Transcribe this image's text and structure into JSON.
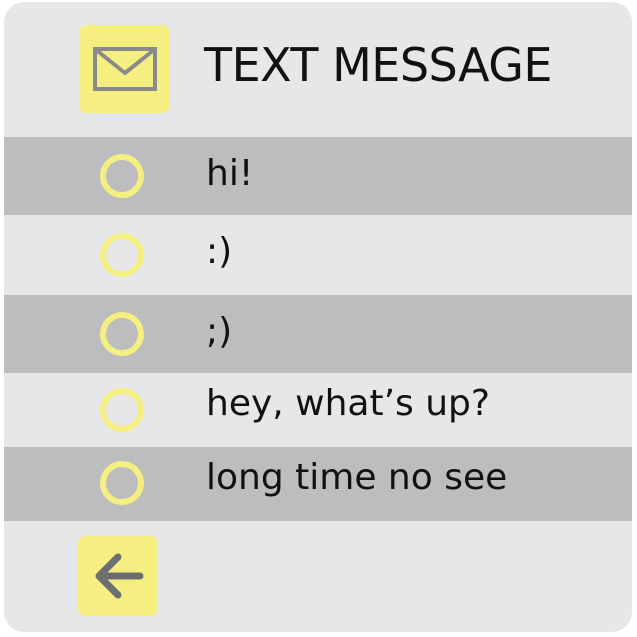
{
  "app": {
    "title": "TEXT MESSAGE"
  },
  "icons": {
    "header": "envelope-icon",
    "back": "arrow-left-icon"
  },
  "colors": {
    "accent": "#f5ef82",
    "background": "#e6e7e8",
    "row_alt": "#bcbdbf",
    "icon_gray": "#6d6e71",
    "text": "#111111"
  },
  "messages": [
    {
      "text": "hi!"
    },
    {
      "text": ":)"
    },
    {
      "text": ";)"
    },
    {
      "text": "hey, what’s up?"
    },
    {
      "text": "long time no see"
    }
  ]
}
